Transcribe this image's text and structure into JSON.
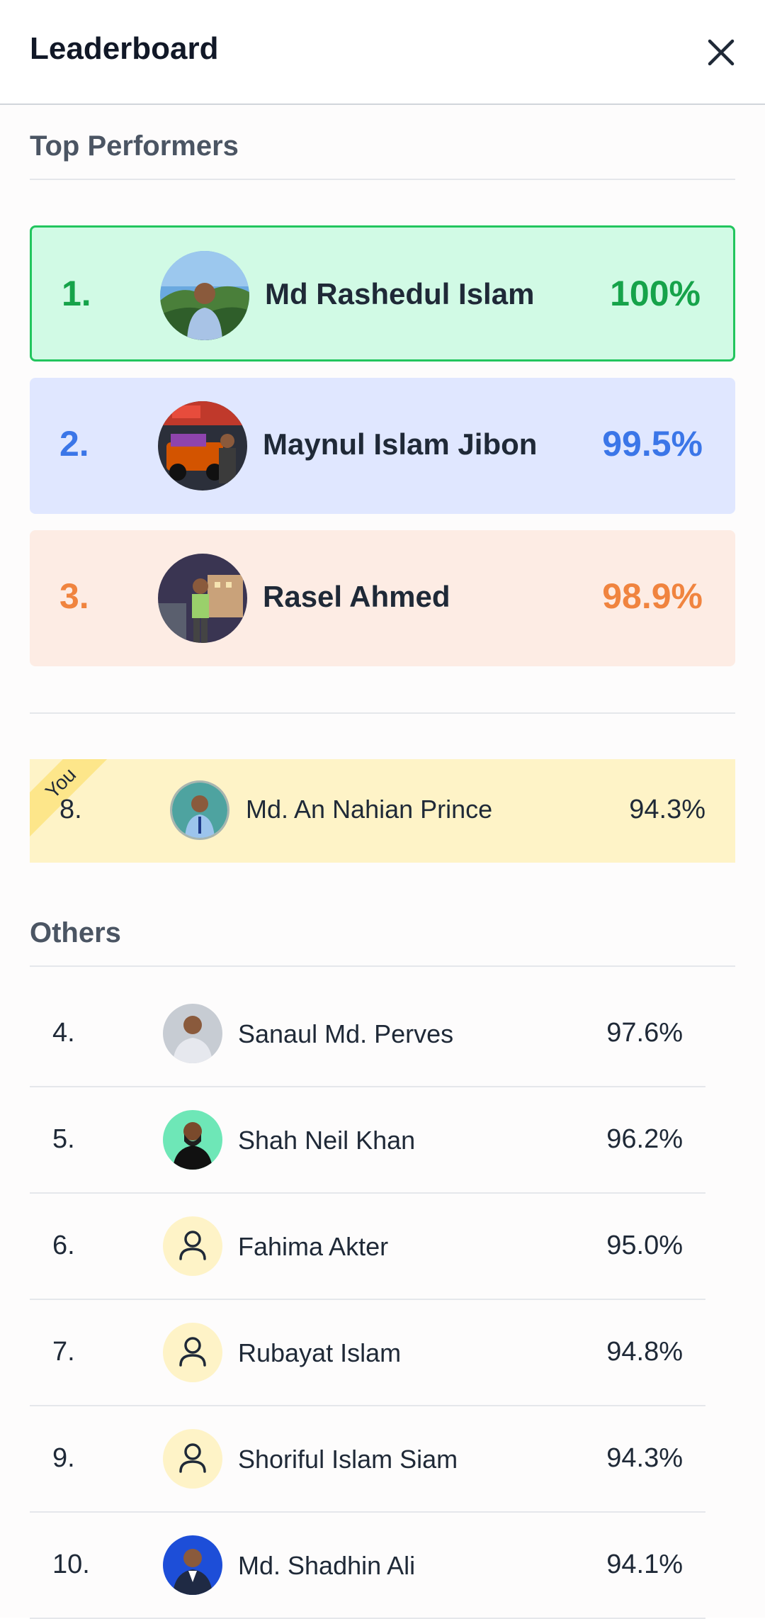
{
  "header": {
    "title": "Leaderboard",
    "close_icon": "close-icon"
  },
  "top_section": {
    "title": "Top Performers"
  },
  "top_performers": [
    {
      "rank": "1.",
      "name": "Md Rashedul Islam",
      "score": "100%"
    },
    {
      "rank": "2.",
      "name": "Maynul Islam Jibon",
      "score": "99.5%"
    },
    {
      "rank": "3.",
      "name": "Rasel Ahmed",
      "score": "98.9%"
    }
  ],
  "current_user": {
    "badge": "You",
    "rank": "8.",
    "name": "Md. An Nahian Prince",
    "score": "94.3%"
  },
  "others_section": {
    "title": "Others"
  },
  "others": [
    {
      "rank": "4.",
      "name": "Sanaul Md. Perves",
      "score": "97.6%",
      "avatar": "photo"
    },
    {
      "rank": "5.",
      "name": "Shah Neil Khan",
      "score": "96.2%",
      "avatar": "photo"
    },
    {
      "rank": "6.",
      "name": "Fahima Akter",
      "score": "95.0%",
      "avatar": "user-icon"
    },
    {
      "rank": "7.",
      "name": "Rubayat Islam",
      "score": "94.8%",
      "avatar": "user-icon"
    },
    {
      "rank": "9.",
      "name": "Shoriful Islam Siam",
      "score": "94.3%",
      "avatar": "user-icon"
    },
    {
      "rank": "10.",
      "name": "Md. Shadhin Ali",
      "score": "94.1%",
      "avatar": "photo"
    }
  ],
  "colors": {
    "first": "#16a34a",
    "second": "#3b76e8",
    "third": "#f0843f",
    "you_bg": "#fef3c7",
    "placeholder_bg": "#fef3c7"
  }
}
